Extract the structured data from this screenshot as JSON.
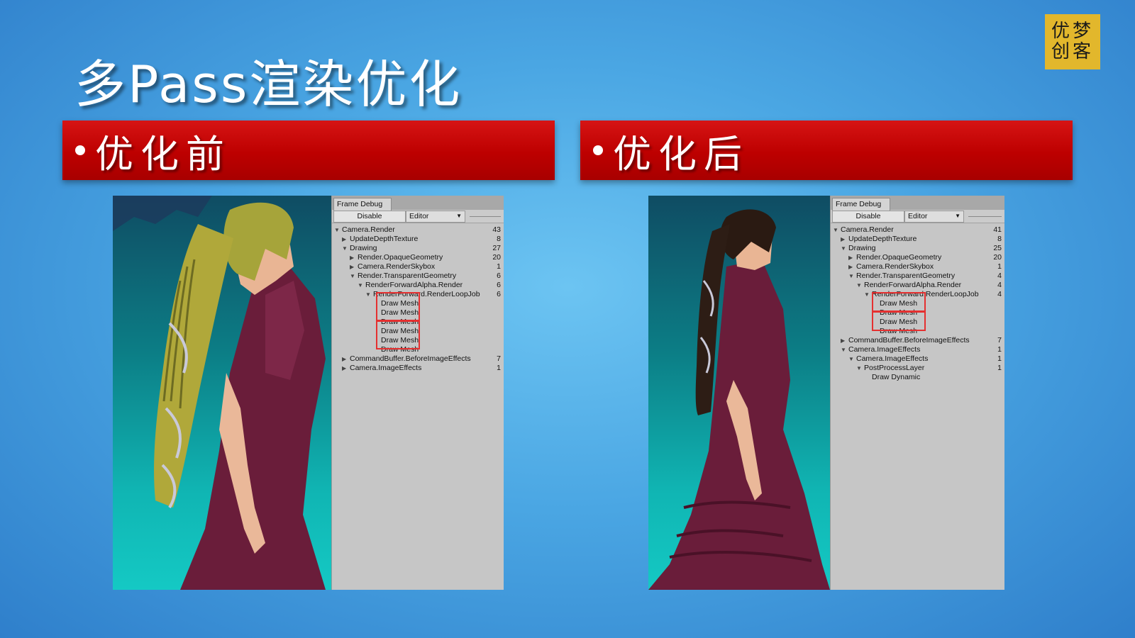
{
  "slide": {
    "title": "多Pass渲染优化",
    "logo_line1": "优梦",
    "logo_line2": "创客",
    "colors": {
      "banner": "#c00000",
      "logo": "#e2b72c",
      "highlight": "#e53030"
    }
  },
  "sections": {
    "before": {
      "label": "优化前",
      "frame_debug": {
        "tab": "Frame Debug",
        "disable_label": "Disable",
        "editor_label": "Editor",
        "rows": [
          {
            "indent": 0,
            "arrow": "down",
            "label": "Camera.Render",
            "count": "43"
          },
          {
            "indent": 1,
            "arrow": "right",
            "label": "UpdateDepthTexture",
            "count": "8"
          },
          {
            "indent": 1,
            "arrow": "down",
            "label": "Drawing",
            "count": "27"
          },
          {
            "indent": 2,
            "arrow": "right",
            "label": "Render.OpaqueGeometry",
            "count": "20"
          },
          {
            "indent": 2,
            "arrow": "right",
            "label": "Camera.RenderSkybox",
            "count": "1"
          },
          {
            "indent": 2,
            "arrow": "down",
            "label": "Render.TransparentGeometry",
            "count": "6"
          },
          {
            "indent": 3,
            "arrow": "down",
            "label": "RenderForwardAlpha.Render",
            "count": "6"
          },
          {
            "indent": 4,
            "arrow": "down",
            "label": "RenderForward.RenderLoopJob",
            "count": "6"
          },
          {
            "indent": 5,
            "arrow": "",
            "label": "Draw Mesh",
            "count": ""
          },
          {
            "indent": 5,
            "arrow": "",
            "label": "Draw Mesh",
            "count": ""
          },
          {
            "indent": 5,
            "arrow": "",
            "label": "Draw Mesh",
            "count": ""
          },
          {
            "indent": 5,
            "arrow": "",
            "label": "Draw Mesh",
            "count": ""
          },
          {
            "indent": 5,
            "arrow": "",
            "label": "Draw Mesh",
            "count": ""
          },
          {
            "indent": 5,
            "arrow": "",
            "label": "Draw Mesh",
            "count": ""
          },
          {
            "indent": 1,
            "arrow": "right",
            "label": "CommandBuffer.BeforeImageEffects",
            "count": "7"
          },
          {
            "indent": 1,
            "arrow": "right",
            "label": "Camera.ImageEffects",
            "count": "1"
          }
        ]
      }
    },
    "after": {
      "label": "优化后",
      "frame_debug": {
        "tab": "Frame Debug",
        "disable_label": "Disable",
        "editor_label": "Editor",
        "rows": [
          {
            "indent": 0,
            "arrow": "down",
            "label": "Camera.Render",
            "count": "41"
          },
          {
            "indent": 1,
            "arrow": "right",
            "label": "UpdateDepthTexture",
            "count": "8"
          },
          {
            "indent": 1,
            "arrow": "down",
            "label": "Drawing",
            "count": "25"
          },
          {
            "indent": 2,
            "arrow": "right",
            "label": "Render.OpaqueGeometry",
            "count": "20"
          },
          {
            "indent": 2,
            "arrow": "right",
            "label": "Camera.RenderSkybox",
            "count": "1"
          },
          {
            "indent": 2,
            "arrow": "down",
            "label": "Render.TransparentGeometry",
            "count": "4"
          },
          {
            "indent": 3,
            "arrow": "down",
            "label": "RenderForwardAlpha.Render",
            "count": "4"
          },
          {
            "indent": 4,
            "arrow": "down",
            "label": "RenderForward.RenderLoopJob",
            "count": "4"
          },
          {
            "indent": 5,
            "arrow": "",
            "label": "Draw Mesh",
            "count": ""
          },
          {
            "indent": 5,
            "arrow": "",
            "label": "Draw Mesh",
            "count": ""
          },
          {
            "indent": 5,
            "arrow": "",
            "label": "Draw Mesh",
            "count": ""
          },
          {
            "indent": 5,
            "arrow": "",
            "label": "Draw Mesh",
            "count": ""
          },
          {
            "indent": 1,
            "arrow": "right",
            "label": "CommandBuffer.BeforeImageEffects",
            "count": "7"
          },
          {
            "indent": 1,
            "arrow": "down",
            "label": "Camera.ImageEffects",
            "count": "1"
          },
          {
            "indent": 2,
            "arrow": "down",
            "label": "Camera.ImageEffects",
            "count": "1"
          },
          {
            "indent": 3,
            "arrow": "down",
            "label": "PostProcessLayer",
            "count": "1"
          },
          {
            "indent": 4,
            "arrow": "",
            "label": "Draw Dynamic",
            "count": ""
          }
        ]
      }
    }
  }
}
